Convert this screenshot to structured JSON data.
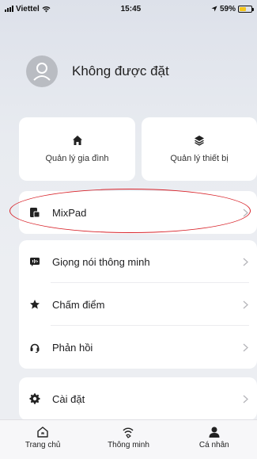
{
  "status_bar": {
    "carrier": "Viettel",
    "time": "15:45",
    "battery": "59%",
    "battery_level": 0.59
  },
  "profile": {
    "name": "Không được đặt"
  },
  "quick_actions": [
    {
      "label": "Quản lý gia đình",
      "icon": "home-icon"
    },
    {
      "label": "Quản lý thiết bị",
      "icon": "layers-icon"
    }
  ],
  "menu": {
    "mixpad": {
      "label": "MixPad",
      "icon": "mixpad-icon"
    },
    "group2": [
      {
        "label": "Giọng nói thông minh",
        "icon": "voice-icon"
      },
      {
        "label": "Chấm điểm",
        "icon": "star-icon"
      },
      {
        "label": "Phản hồi",
        "icon": "headset-icon"
      }
    ],
    "settings": {
      "label": "Cài đặt",
      "icon": "gear-icon"
    }
  },
  "tabbar": [
    {
      "label": "Trang chủ",
      "icon": "home-outline-icon"
    },
    {
      "label": "Thông minh",
      "icon": "smart-icon"
    },
    {
      "label": "Cá nhân",
      "icon": "person-icon",
      "active": true
    }
  ],
  "colors": {
    "highlight": "#d8232a",
    "battery": "#f5c518"
  }
}
